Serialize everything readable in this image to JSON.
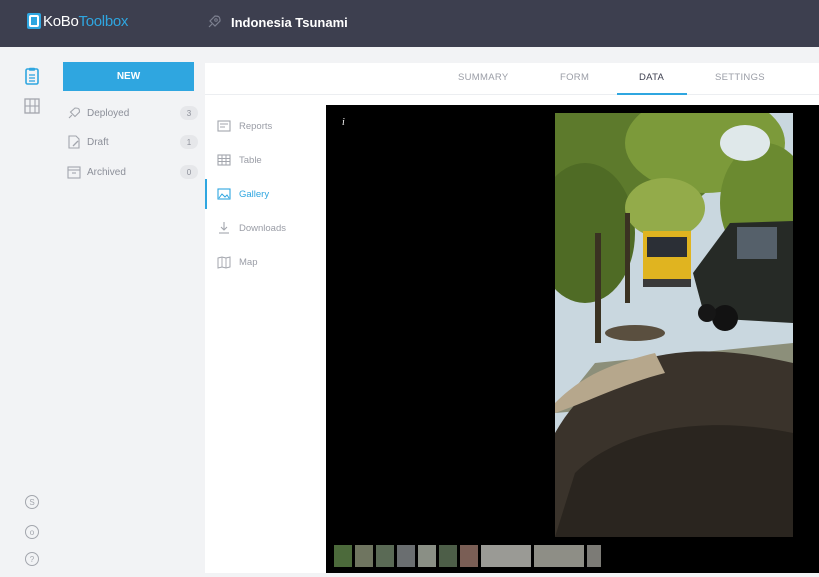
{
  "app": {
    "logo_primary": "KoBo",
    "logo_secondary": "Toolbox",
    "project_title": "Indonesia Tsunami",
    "accent_color": "#2fa6e0",
    "topbar_color": "#3d3f4f"
  },
  "rail": {
    "icons": [
      "projects-clipboard-icon",
      "library-grid-icon"
    ],
    "bottom_icons": [
      "help-support-icon",
      "github-icon",
      "question-help-icon"
    ]
  },
  "sidebar": {
    "new_label": "NEW",
    "items": [
      {
        "label": "Deployed",
        "count": "3",
        "icon": "rocket-icon"
      },
      {
        "label": "Draft",
        "count": "1",
        "icon": "draft-edit-icon"
      },
      {
        "label": "Archived",
        "count": "0",
        "icon": "archive-box-icon"
      }
    ]
  },
  "tabs": [
    {
      "label": "SUMMARY",
      "active": false
    },
    {
      "label": "FORM",
      "active": false
    },
    {
      "label": "DATA",
      "active": true
    },
    {
      "label": "SETTINGS",
      "active": false
    }
  ],
  "subnav": [
    {
      "label": "Reports",
      "icon": "reports-icon",
      "active": false
    },
    {
      "label": "Table",
      "icon": "table-icon",
      "active": false
    },
    {
      "label": "Gallery",
      "icon": "gallery-icon",
      "active": true
    },
    {
      "label": "Downloads",
      "icon": "download-icon",
      "active": false
    },
    {
      "label": "Map",
      "icon": "map-icon",
      "active": false
    }
  ],
  "gallery": {
    "info_label": "i",
    "thumbnail_count": 10
  }
}
